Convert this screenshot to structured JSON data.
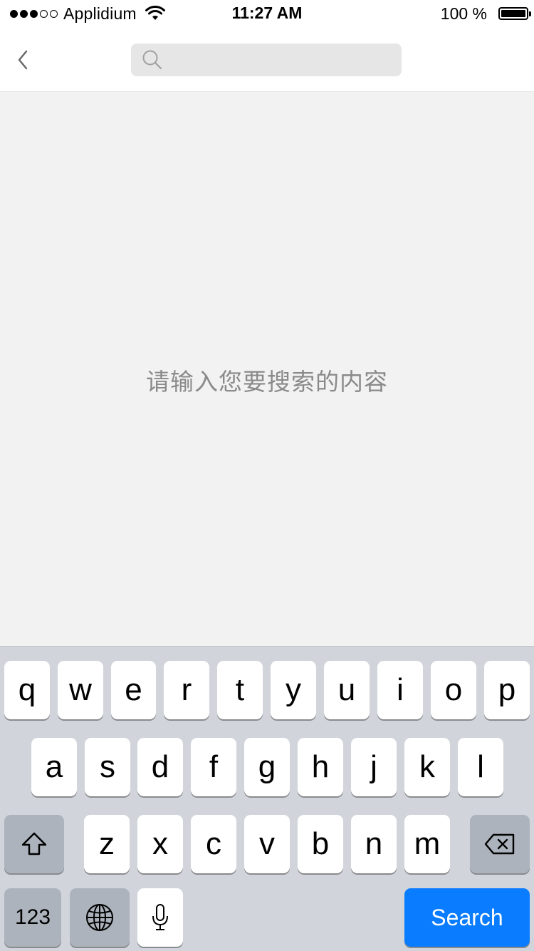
{
  "status_bar": {
    "carrier": "Applidium",
    "time": "11:27 AM",
    "battery": "100 %",
    "signal_icon": "signal-dots-icon",
    "wifi_icon": "wifi-icon",
    "battery_icon": "battery-icon"
  },
  "nav": {
    "back_icon": "chevron-left-icon",
    "search_icon": "search-icon",
    "search_value": "",
    "search_placeholder": ""
  },
  "main": {
    "empty_hint": "请输入您要搜索的内容"
  },
  "keyboard": {
    "row1": [
      "q",
      "w",
      "e",
      "r",
      "t",
      "y",
      "u",
      "i",
      "o",
      "p"
    ],
    "row2": [
      "a",
      "s",
      "d",
      "f",
      "g",
      "h",
      "j",
      "k",
      "l"
    ],
    "row3": [
      "z",
      "x",
      "c",
      "v",
      "b",
      "n",
      "m"
    ],
    "shift_icon": "shift-icon",
    "delete_icon": "delete-icon",
    "numbers_label": "123",
    "globe_icon": "globe-icon",
    "mic_icon": "microphone-icon",
    "space_label": "",
    "search_label": "Search",
    "colors": {
      "background": "#d1d5db",
      "key": "#ffffff",
      "special_key": "#acb3bc",
      "search_key": "#0a7cff"
    }
  }
}
